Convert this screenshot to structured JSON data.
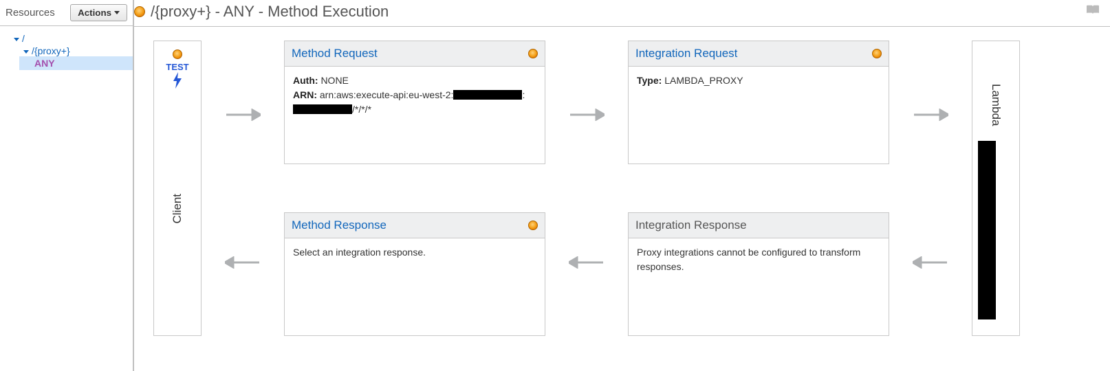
{
  "sidebar": {
    "title": "Resources",
    "actions_label": "Actions",
    "tree": {
      "root": "/",
      "proxy": "/{proxy+}",
      "method": "ANY"
    }
  },
  "page": {
    "title": "/{proxy+} - ANY - Method Execution"
  },
  "client": {
    "test_label": "TEST",
    "label": "Client"
  },
  "lambda": {
    "label": "Lambda"
  },
  "cards": {
    "method_request": {
      "title": "Method Request",
      "auth_label": "Auth:",
      "auth_value": "NONE",
      "arn_label": "ARN:",
      "arn_pre": "arn:aws:execute-api:eu-west-2:",
      "arn_post": "/*/*/*"
    },
    "integration_request": {
      "title": "Integration Request",
      "type_label": "Type:",
      "type_value": "LAMBDA_PROXY"
    },
    "method_response": {
      "title": "Method Response",
      "body": "Select an integration response."
    },
    "integration_response": {
      "title": "Integration Response",
      "body": "Proxy integrations cannot be configured to transform responses."
    }
  }
}
